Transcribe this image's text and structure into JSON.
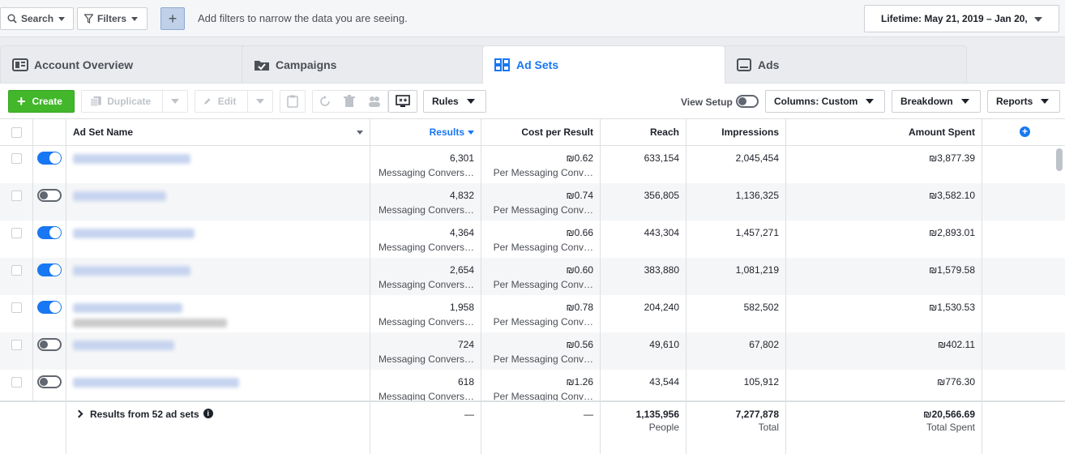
{
  "filterbar": {
    "search_label": "Search",
    "filters_label": "Filters",
    "add_label": "+",
    "hint": "Add filters to narrow the data you are seeing.",
    "date_range": "Lifetime: May 21, 2019 – Jan 20,"
  },
  "tabs": [
    {
      "label": "Account Overview",
      "icon": "account-overview-icon"
    },
    {
      "label": "Campaigns",
      "icon": "folder-check-icon"
    },
    {
      "label": "Ad Sets",
      "icon": "grid-icon",
      "active": true
    },
    {
      "label": "Ads",
      "icon": "ad-monitor-icon"
    }
  ],
  "toolbar": {
    "create_label": "Create",
    "duplicate_label": "Duplicate",
    "edit_label": "Edit",
    "rules_label": "Rules",
    "view_setup_label": "View Setup",
    "columns_label": "Columns: Custom",
    "breakdown_label": "Breakdown",
    "reports_label": "Reports"
  },
  "table": {
    "headers": {
      "name": "Ad Set Name",
      "results": "Results",
      "cost": "Cost per Result",
      "reach": "Reach",
      "impressions": "Impressions",
      "spent": "Amount Spent"
    },
    "rows": [
      {
        "on": true,
        "results": "6,301",
        "results_sub": "Messaging Convers…",
        "cost": "₪0.62",
        "cost_sub": "Per Messaging Conv…",
        "reach": "633,154",
        "impressions": "2,045,454",
        "spent": "₪3,877.39"
      },
      {
        "on": false,
        "results": "4,832",
        "results_sub": "Messaging Convers…",
        "cost": "₪0.74",
        "cost_sub": "Per Messaging Conv…",
        "reach": "356,805",
        "impressions": "1,136,325",
        "spent": "₪3,582.10"
      },
      {
        "on": true,
        "results": "4,364",
        "results_sub": "Messaging Convers…",
        "cost": "₪0.66",
        "cost_sub": "Per Messaging Conv…",
        "reach": "443,304",
        "impressions": "1,457,271",
        "spent": "₪2,893.01"
      },
      {
        "on": true,
        "results": "2,654",
        "results_sub": "Messaging Convers…",
        "cost": "₪0.60",
        "cost_sub": "Per Messaging Conv…",
        "reach": "383,880",
        "impressions": "1,081,219",
        "spent": "₪1,579.58"
      },
      {
        "on": true,
        "results": "1,958",
        "results_sub": "Messaging Convers…",
        "cost": "₪0.78",
        "cost_sub": "Per Messaging Conv…",
        "reach": "204,240",
        "impressions": "582,502",
        "spent": "₪1,530.53"
      },
      {
        "on": false,
        "results": "724",
        "results_sub": "Messaging Convers…",
        "cost": "₪0.56",
        "cost_sub": "Per Messaging Conv…",
        "reach": "49,610",
        "impressions": "67,802",
        "spent": "₪402.11"
      },
      {
        "on": false,
        "results": "618",
        "results_sub": "Messaging Convers…",
        "cost": "₪1.26",
        "cost_sub": "Per Messaging Conv…",
        "reach": "43,544",
        "impressions": "105,912",
        "spent": "₪776.30"
      }
    ],
    "footer": {
      "label": "Results from 52 ad sets",
      "results": "—",
      "cost": "—",
      "reach": "1,135,956",
      "reach_sub": "People",
      "impressions": "7,277,878",
      "impressions_sub": "Total",
      "spent": "₪20,566.69",
      "spent_sub": "Total Spent"
    }
  },
  "colors": {
    "accent": "#1877f2",
    "create": "#42b72a"
  }
}
